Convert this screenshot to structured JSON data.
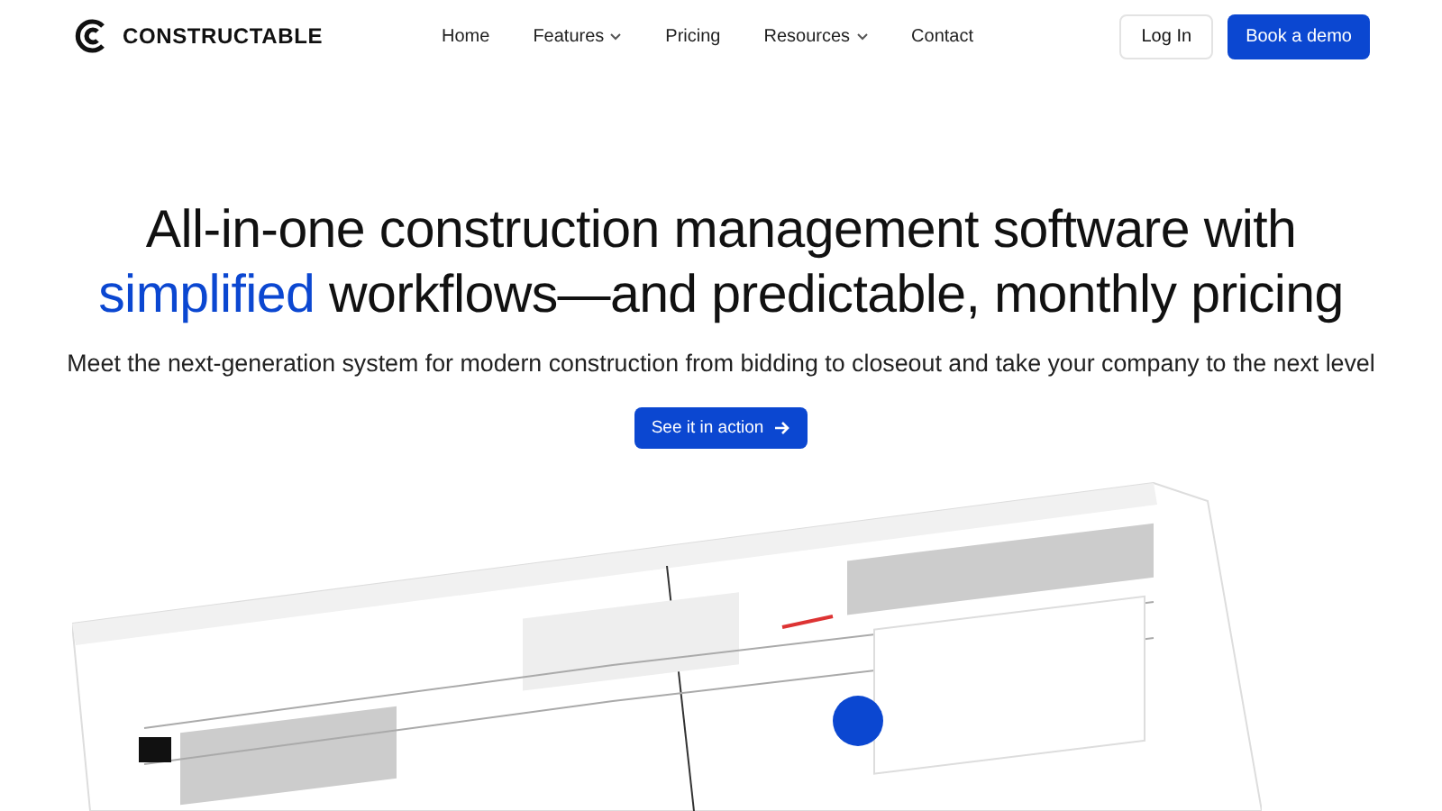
{
  "header": {
    "logo_text": "CONSTRUCTABLE",
    "nav": [
      {
        "label": "Home",
        "has_menu": false
      },
      {
        "label": "Features",
        "has_menu": true
      },
      {
        "label": "Pricing",
        "has_menu": false
      },
      {
        "label": "Resources",
        "has_menu": true
      },
      {
        "label": "Contact",
        "has_menu": false
      }
    ],
    "login_button": "Log In",
    "demo_button": "Book a demo"
  },
  "hero": {
    "headline": "All-in-one construction management software with",
    "headline_highlight": "simplified",
    "headline_rest": "workflows—and predictable, monthly pricing",
    "subtitle": "Meet the next-generation system for modern construction from bidding to closeout and take your company to the next level",
    "cta": "See it in action"
  }
}
